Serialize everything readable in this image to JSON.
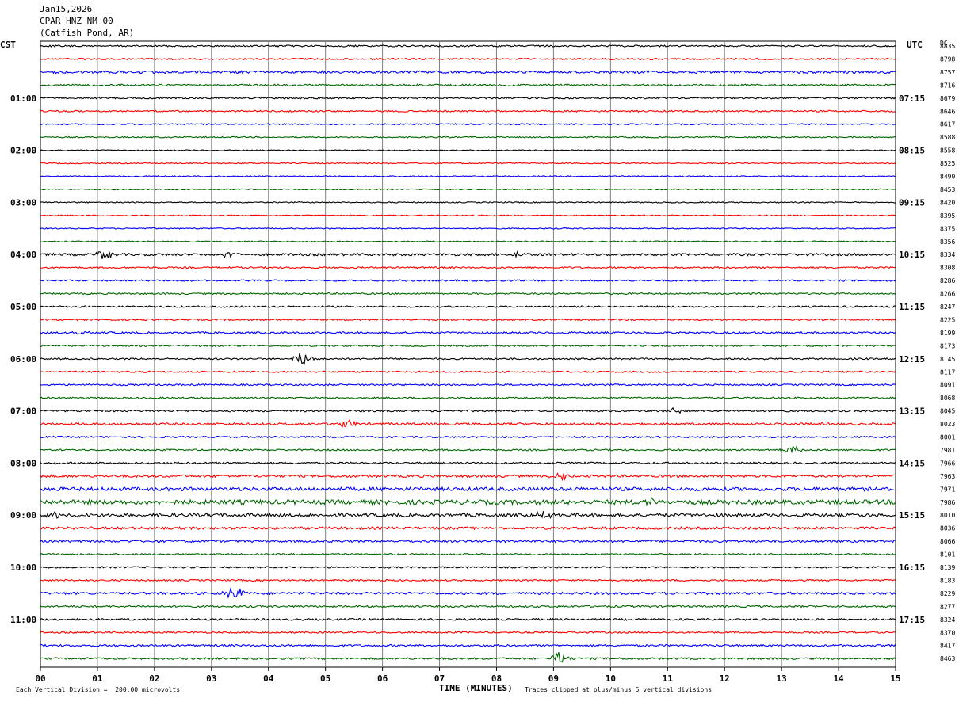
{
  "header": {
    "date": "Jan15,2026",
    "station": "CPAR HNZ NM 00",
    "location": "(Catfish Pond, AR)"
  },
  "left_tz": "CST",
  "right_tz": "UTC",
  "dc_label": "DC",
  "footer": {
    "scale": "Each Vertical Division =  200.00 microvolts",
    "xlabel": "TIME (MINUTES)",
    "clip_note": "Traces clipped at plus/minus 5 vertical divisions"
  },
  "colors": {
    "trace_cycle": [
      "#000000",
      "#ff0000",
      "#0000ff",
      "#006600"
    ],
    "grid": "#808080"
  },
  "chart_data": {
    "type": "line",
    "title": "CPAR HNZ NM 00",
    "xlabel": "TIME (MINUTES)",
    "xlim": [
      0,
      15
    ],
    "x_ticks": [
      "00",
      "01",
      "02",
      "03",
      "04",
      "05",
      "06",
      "07",
      "08",
      "09",
      "10",
      "11",
      "12",
      "13",
      "14",
      "15"
    ],
    "rows_per_hour": 4,
    "left_hour_labels": [
      "01:00",
      "02:00",
      "03:00",
      "04:00",
      "05:00",
      "06:00",
      "07:00",
      "08:00",
      "09:00",
      "10:00",
      "11:00"
    ],
    "right_hour_labels": [
      "07:15",
      "08:15",
      "09:15",
      "10:15",
      "11:15",
      "12:15",
      "13:15",
      "14:15",
      "15:15",
      "16:15",
      "17:15"
    ],
    "dc_offsets": [
      "8835",
      "8798",
      "8757",
      "8716",
      "8679",
      "8646",
      "8617",
      "8588",
      "8558",
      "8525",
      "8490",
      "8453",
      "8420",
      "8395",
      "8375",
      "8356",
      "8334",
      "8308",
      "8286",
      "8266",
      "8247",
      "8225",
      "8199",
      "8173",
      "8145",
      "8117",
      "8091",
      "8068",
      "8045",
      "8023",
      "8001",
      "7981",
      "7966",
      "7963",
      "7971",
      "7986",
      "8010",
      "8036",
      "8066",
      "8101",
      "8139",
      "8183",
      "8229",
      "8277",
      "8324",
      "8370",
      "8417",
      "8463"
    ],
    "trace_noise": [
      1,
      1,
      1.6,
      1.2,
      1,
      1,
      0.8,
      0.8,
      0.6,
      0.7,
      0.7,
      0.7,
      0.7,
      0.7,
      0.7,
      0.7,
      1.5,
      1,
      1,
      1,
      1,
      1,
      1.2,
      1,
      1,
      1,
      1,
      1,
      1.2,
      1.4,
      1,
      1,
      1.2,
      1.6,
      2.2,
      2.8,
      2,
      1.6,
      1.4,
      1,
      1,
      1,
      1.5,
      1.2,
      1.2,
      1,
      1.2,
      1.2
    ],
    "events": [
      {
        "row": 16,
        "minute": 1.1,
        "amp": 6
      },
      {
        "row": 16,
        "minute": 3.3,
        "amp": 5
      },
      {
        "row": 16,
        "minute": 8.4,
        "amp": 5
      },
      {
        "row": 22,
        "minute": 0.65,
        "amp": 4
      },
      {
        "row": 24,
        "minute": 4.6,
        "amp": 9
      },
      {
        "row": 28,
        "minute": 11.1,
        "amp": 5
      },
      {
        "row": 29,
        "minute": 5.4,
        "amp": 5
      },
      {
        "row": 31,
        "minute": 13.2,
        "amp": 7
      },
      {
        "row": 33,
        "minute": 9.1,
        "amp": 6
      },
      {
        "row": 35,
        "minute": 10.7,
        "amp": 5
      },
      {
        "row": 36,
        "minute": 0.2,
        "amp": 5
      },
      {
        "row": 36,
        "minute": 8.8,
        "amp": 5
      },
      {
        "row": 42,
        "minute": 3.4,
        "amp": 8
      },
      {
        "row": 47,
        "minute": 9.1,
        "amp": 8
      }
    ]
  }
}
